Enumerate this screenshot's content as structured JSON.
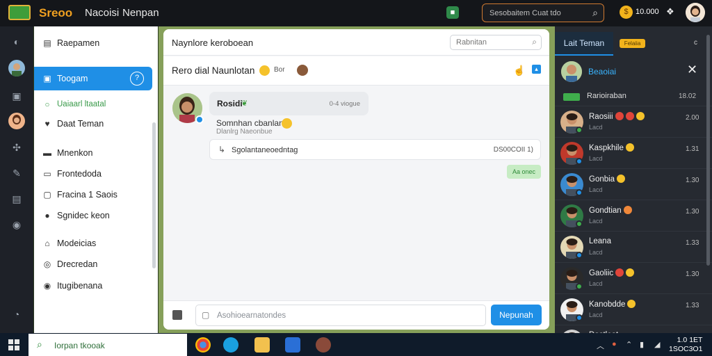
{
  "topbar": {
    "brand": "Sreoo",
    "title_a": "Nacoisi",
    "title_b": "Nenpan",
    "search_placeholder": "Sesobaitem Cuat tdo",
    "coins": "10.000",
    "accent_color": "#f0a020"
  },
  "rail": {
    "icons": [
      "compass-icon",
      "avatar",
      "building-icon",
      "avatar",
      "puzzle-icon",
      "pen-icon",
      "calendar-icon",
      "settings-icon",
      "help-icon"
    ]
  },
  "nav": {
    "items": [
      {
        "label": "Raepamen",
        "icon": "folder-icon"
      },
      {
        "label": "Toogam",
        "icon": "users-icon",
        "active": true,
        "badge": "?"
      },
      {
        "label": "Uaiaarl ltaatal",
        "icon": "leaf-icon"
      },
      {
        "label": "Daat Teman",
        "icon": "heart-icon"
      },
      {
        "label": "Mnenkon",
        "icon": "message-icon"
      },
      {
        "label": "Frontedoda",
        "icon": "document-icon"
      },
      {
        "label": "Fracina 1 Saois",
        "icon": "list-icon"
      },
      {
        "label": "Sgnidec keon",
        "icon": "info-icon"
      },
      {
        "label": "Modeicias",
        "icon": "home-icon"
      },
      {
        "label": "Drecredan",
        "icon": "clock-icon"
      },
      {
        "label": "Itugibenana",
        "icon": "target-icon"
      }
    ]
  },
  "chat": {
    "top_title": "Naynlore keroboean",
    "search_placeholder": "Rabnitan",
    "header_title": "Rero dial Naunlotan",
    "header_extra": "Bor",
    "message": {
      "name": "Rosidi",
      "time": "0-4 viogue",
      "text": "Somnhan cbanlan",
      "sub": "Dlanlrg Naeonbue",
      "reply_text": "Sgolantaneoedntag",
      "reply_time": "DS00COII 1)",
      "sent_chip": "Aa onec"
    },
    "compose_placeholder": "Asohioearnatondes",
    "send_label": "Nepunah"
  },
  "friends": {
    "tab_label": "Lait Teman",
    "tab_badge": "Felaiia",
    "tab_more": "c",
    "header_name": "Beaoiai",
    "section_label": "Rarioiraban",
    "section_time": "18.02",
    "rows": [
      {
        "name": "Raosiii",
        "sub": "Lacd",
        "time": "2.00",
        "bg": "#d8b08a",
        "online": "#3fae4c",
        "emojis": [
          "#e0453a",
          "#e0453a",
          "#f5c22b"
        ]
      },
      {
        "name": "Kaspkhile",
        "sub": "Lacd",
        "time": "1.31",
        "bg": "#c0392b",
        "online": "#1f8fe6",
        "emojis": [
          "#f5c22b"
        ]
      },
      {
        "name": "Gonbia",
        "sub": "Lacd",
        "time": "1.30",
        "bg": "#3a8ad0",
        "online": "#1f8fe6",
        "emojis": [
          "#f5c22b"
        ]
      },
      {
        "name": "Gondtian",
        "sub": "Lacd",
        "time": "1.30",
        "bg": "#2f7a45",
        "online": "#3fae4c",
        "emojis": [
          "#f0883a"
        ]
      },
      {
        "name": "Leana",
        "sub": "Lacd",
        "time": "1.33",
        "bg": "#e3d8b5",
        "online": "#1f8fe6",
        "emojis": []
      },
      {
        "name": "Gaoliic",
        "sub": "Lacd",
        "time": "1.30",
        "bg": "#2a2a2a",
        "online": "#3fae4c",
        "emojis": [
          "#e0453a",
          "#f5c22b"
        ]
      },
      {
        "name": "Kanobdde",
        "sub": "Lacd",
        "time": "1.33",
        "bg": "#f0f0f0",
        "online": "#1f8fe6",
        "emojis": [
          "#f5c22b"
        ]
      },
      {
        "name": "Dastleat",
        "sub": "",
        "time": "",
        "bg": "#d0d0d0",
        "online": "#3fae4c",
        "emojis": []
      }
    ]
  },
  "taskbar": {
    "search_placeholder": "Iorpan tkooak",
    "apps": [
      "chrome-icon",
      "chat-app-icon",
      "folder-icon",
      "store-icon",
      "user-app-icon"
    ],
    "clock_time": "1.0",
    "clock_date": "1SOC3O1",
    "clock_extra": "1ET"
  }
}
